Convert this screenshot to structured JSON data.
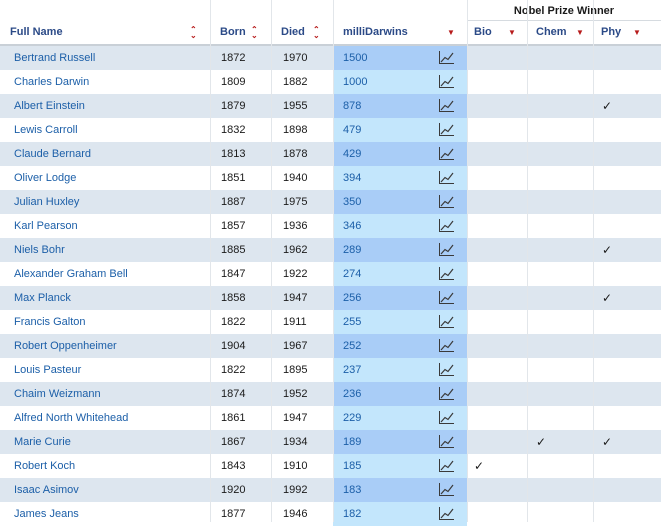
{
  "header": {
    "group_title": "Nobel Prize Winner",
    "columns": [
      "Full Name",
      "Born",
      "Died",
      "milliDarwins",
      "Bio",
      "Chem",
      "Phy"
    ]
  },
  "rows": [
    {
      "name": "Bertrand Russell",
      "born": "1872",
      "died": "1970",
      "md": "1500",
      "bio": "",
      "chem": "",
      "phy": ""
    },
    {
      "name": "Charles Darwin",
      "born": "1809",
      "died": "1882",
      "md": "1000",
      "bio": "",
      "chem": "",
      "phy": ""
    },
    {
      "name": "Albert Einstein",
      "born": "1879",
      "died": "1955",
      "md": "878",
      "bio": "",
      "chem": "",
      "phy": "✓"
    },
    {
      "name": "Lewis Carroll",
      "born": "1832",
      "died": "1898",
      "md": "479",
      "bio": "",
      "chem": "",
      "phy": ""
    },
    {
      "name": "Claude Bernard",
      "born": "1813",
      "died": "1878",
      "md": "429",
      "bio": "",
      "chem": "",
      "phy": ""
    },
    {
      "name": "Oliver Lodge",
      "born": "1851",
      "died": "1940",
      "md": "394",
      "bio": "",
      "chem": "",
      "phy": ""
    },
    {
      "name": "Julian Huxley",
      "born": "1887",
      "died": "1975",
      "md": "350",
      "bio": "",
      "chem": "",
      "phy": ""
    },
    {
      "name": "Karl Pearson",
      "born": "1857",
      "died": "1936",
      "md": "346",
      "bio": "",
      "chem": "",
      "phy": ""
    },
    {
      "name": "Niels Bohr",
      "born": "1885",
      "died": "1962",
      "md": "289",
      "bio": "",
      "chem": "",
      "phy": "✓"
    },
    {
      "name": "Alexander Graham Bell",
      "born": "1847",
      "died": "1922",
      "md": "274",
      "bio": "",
      "chem": "",
      "phy": ""
    },
    {
      "name": "Max Planck",
      "born": "1858",
      "died": "1947",
      "md": "256",
      "bio": "",
      "chem": "",
      "phy": "✓"
    },
    {
      "name": "Francis Galton",
      "born": "1822",
      "died": "1911",
      "md": "255",
      "bio": "",
      "chem": "",
      "phy": ""
    },
    {
      "name": "Robert Oppenheimer",
      "born": "1904",
      "died": "1967",
      "md": "252",
      "bio": "",
      "chem": "",
      "phy": ""
    },
    {
      "name": "Louis Pasteur",
      "born": "1822",
      "died": "1895",
      "md": "237",
      "bio": "",
      "chem": "",
      "phy": ""
    },
    {
      "name": "Chaim Weizmann",
      "born": "1874",
      "died": "1952",
      "md": "236",
      "bio": "",
      "chem": "",
      "phy": ""
    },
    {
      "name": "Alfred North Whitehead",
      "born": "1861",
      "died": "1947",
      "md": "229",
      "bio": "",
      "chem": "",
      "phy": ""
    },
    {
      "name": "Marie Curie",
      "born": "1867",
      "died": "1934",
      "md": "189",
      "bio": "",
      "chem": "✓",
      "phy": "✓"
    },
    {
      "name": "Robert Koch",
      "born": "1843",
      "died": "1910",
      "md": "185",
      "bio": "✓",
      "chem": "",
      "phy": ""
    },
    {
      "name": "Isaac Asimov",
      "born": "1920",
      "died": "1992",
      "md": "183",
      "bio": "",
      "chem": "",
      "phy": ""
    },
    {
      "name": "James Jeans",
      "born": "1877",
      "died": "1946",
      "md": "182",
      "bio": "",
      "chem": "",
      "phy": ""
    }
  ],
  "colors": {
    "row_even": "#dde6ef",
    "row_odd": "#ffffff",
    "md_even": "#a9cdf7",
    "md_odd": "#c3e6fc",
    "accent": "#b71b1b",
    "link": "#1c5fa8"
  }
}
